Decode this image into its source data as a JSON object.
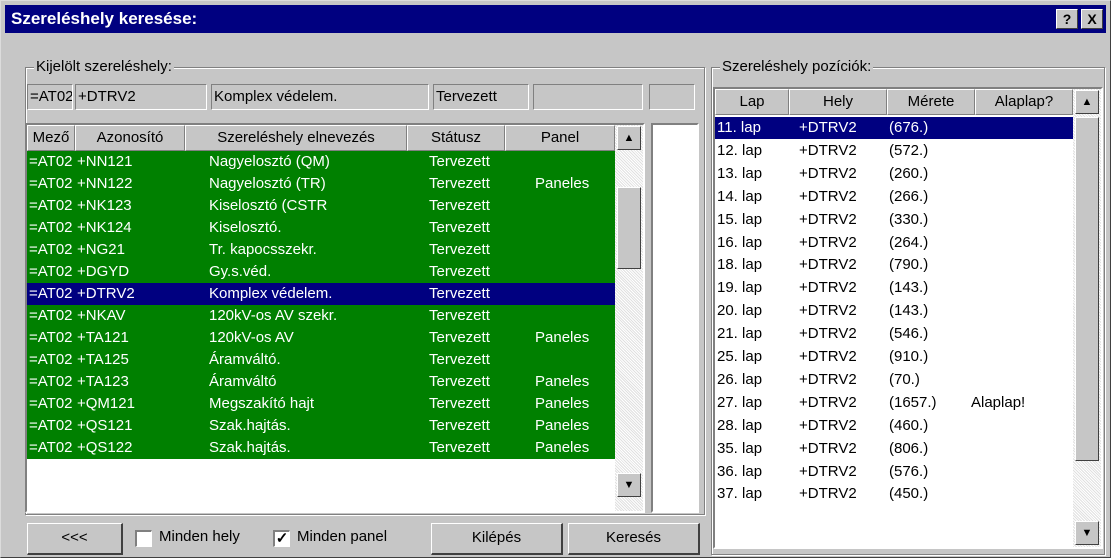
{
  "window": {
    "title": "Szereléshely keresése:",
    "help_label": "?",
    "close_label": "X"
  },
  "selected": {
    "group_label": "Kijelölt szereléshely:",
    "fields": [
      "=AT02",
      "+DTRV2",
      "Komplex védelem.",
      "Tervezett",
      "",
      ""
    ]
  },
  "left_table": {
    "columns": [
      "Mező",
      "Azonosító",
      "Szereléshely elnevezés",
      "Státusz",
      "Panel"
    ],
    "selected_index": 6,
    "rows": [
      [
        "=AT02",
        "+NN121",
        "Nagyelosztó (QM)",
        "Tervezett",
        ""
      ],
      [
        "=AT02",
        "+NN122",
        "Nagyelosztó (TR)",
        "Tervezett",
        "Paneles"
      ],
      [
        "=AT02",
        "+NK123",
        "Kiselosztó (CSTR",
        "Tervezett",
        ""
      ],
      [
        "=AT02",
        "+NK124",
        "Kiselosztó.",
        "Tervezett",
        ""
      ],
      [
        "=AT02",
        "+NG21",
        "Tr. kapocsszekr.",
        "Tervezett",
        ""
      ],
      [
        "=AT02",
        "+DGYD",
        "Gy.s.véd.",
        "Tervezett",
        ""
      ],
      [
        "=AT02",
        "+DTRV2",
        "Komplex védelem.",
        "Tervezett",
        ""
      ],
      [
        "=AT02",
        "+NKAV",
        "120kV-os AV szekr.",
        "Tervezett",
        ""
      ],
      [
        "=AT02",
        "+TA121",
        "120kV-os AV",
        "Tervezett",
        "Paneles"
      ],
      [
        "=AT02",
        "+TA125",
        "Áramváltó.",
        "Tervezett",
        ""
      ],
      [
        "=AT02",
        "+TA123",
        "Áramváltó",
        "Tervezett",
        "Paneles"
      ],
      [
        "=AT02",
        "+QM121",
        "Megszakító hajt",
        "Tervezett",
        "Paneles"
      ],
      [
        "=AT02",
        "+QS121",
        "Szak.hajtás.",
        "Tervezett",
        "Paneles"
      ],
      [
        "=AT02",
        "+QS122",
        "Szak.hajtás.",
        "Tervezett",
        "Paneles"
      ]
    ]
  },
  "right_panel": {
    "group_label": "Szereléshely pozíciók:",
    "columns": [
      "Lap",
      "Hely",
      "Mérete",
      "Alaplap?"
    ],
    "selected_index": 0,
    "rows": [
      [
        "11. lap",
        "+DTRV2",
        "(676.)",
        ""
      ],
      [
        "12. lap",
        "+DTRV2",
        "(572.)",
        ""
      ],
      [
        "13. lap",
        "+DTRV2",
        "(260.)",
        ""
      ],
      [
        "14. lap",
        "+DTRV2",
        "(266.)",
        ""
      ],
      [
        "15. lap",
        "+DTRV2",
        "(330.)",
        ""
      ],
      [
        "16. lap",
        "+DTRV2",
        "(264.)",
        ""
      ],
      [
        "18. lap",
        "+DTRV2",
        "(790.)",
        ""
      ],
      [
        "19. lap",
        "+DTRV2",
        "(143.)",
        ""
      ],
      [
        "20. lap",
        "+DTRV2",
        "(143.)",
        ""
      ],
      [
        "21. lap",
        "+DTRV2",
        "(546.)",
        ""
      ],
      [
        "25. lap",
        "+DTRV2",
        "(910.)",
        ""
      ],
      [
        "26. lap",
        "+DTRV2",
        "(70.)",
        ""
      ],
      [
        "27. lap",
        "+DTRV2",
        "(1657.)",
        "Alaplap!"
      ],
      [
        "28. lap",
        "+DTRV2",
        "(460.)",
        ""
      ],
      [
        "35. lap",
        "+DTRV2",
        "(806.)",
        ""
      ],
      [
        "36. lap",
        "+DTRV2",
        "(576.)",
        ""
      ],
      [
        "37. lap",
        "+DTRV2",
        "(450.)",
        ""
      ]
    ]
  },
  "bottom": {
    "back_label": "<<<",
    "all_places_label": "Minden hely",
    "all_places_checked": false,
    "all_panels_label": "Minden panel",
    "all_panels_checked": true,
    "exit_label": "Kilépés",
    "search_label": "Keresés"
  },
  "scroll_icons": {
    "up": "▲",
    "down": "▼",
    "check": "✓"
  },
  "colors": {
    "title_bg": "#000080",
    "row_green": "#008000",
    "selection": "#000080",
    "face": "#c6c6c6"
  }
}
